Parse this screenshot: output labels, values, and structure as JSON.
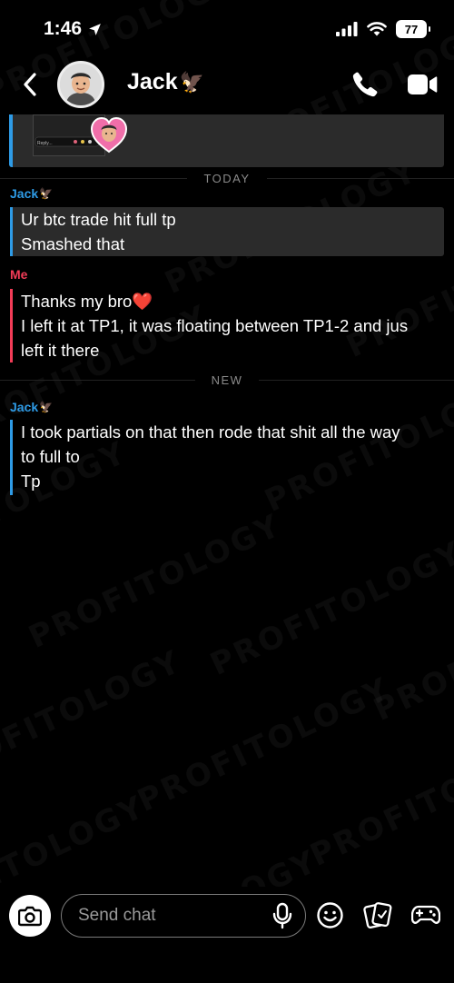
{
  "status_bar": {
    "time": "1:46",
    "battery": "77"
  },
  "header": {
    "contact_name": "Jack",
    "contact_emoji": "🦅"
  },
  "watermark": "PROFITOLOGY",
  "chat": {
    "previous_media": {
      "thumb_caption": "Reply..."
    },
    "day_divider": "TODAY",
    "new_divider": "NEW",
    "messages": [
      {
        "sender": "Jack",
        "sender_emoji": "🦅",
        "saved": true,
        "lines": [
          "Ur btc trade hit full tp",
          "Smashed that"
        ]
      },
      {
        "sender": "Me",
        "sender_emoji": "",
        "lines": [
          "Thanks my bro❤️",
          "I left it at TP1, it was floating between TP1-2 and jus",
          "left it there"
        ]
      },
      {
        "sender": "Jack",
        "sender_emoji": "🦅",
        "lines": [
          "I took partials on that then rode that shit all the way",
          "to full to",
          "Tp"
        ]
      }
    ]
  },
  "composer": {
    "placeholder": "Send chat"
  },
  "icons": {
    "back": "chevron-left-icon",
    "call": "phone-icon",
    "video": "video-camera-icon",
    "camera": "camera-icon",
    "mic": "microphone-icon",
    "emoji": "smiley-icon",
    "stickers": "sticker-icon",
    "games": "gamepad-icon"
  },
  "colors": {
    "friend": "#2e9be6",
    "me": "#f23c57",
    "background": "#000000",
    "saved_message_bg": "#2b2b2b"
  }
}
